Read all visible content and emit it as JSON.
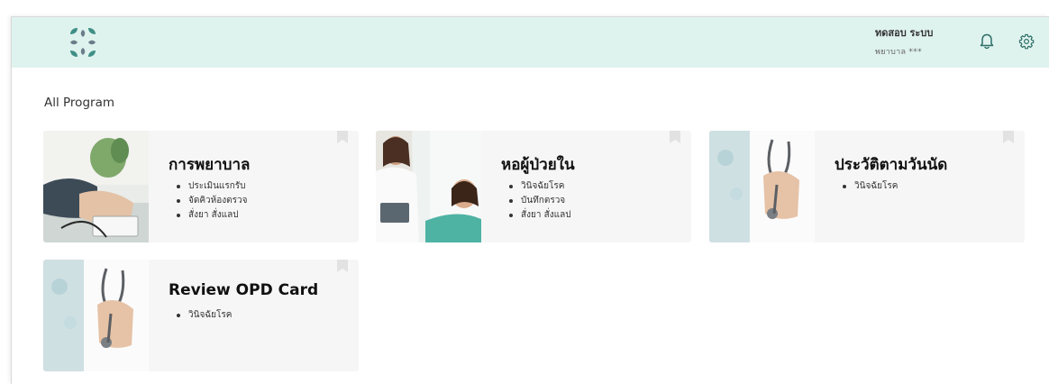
{
  "header": {
    "logo_icon": "clover-logo-icon",
    "user_name": "ทดสอบ ระบบ",
    "user_role": "พยาบาล ***",
    "bell_icon": "bell-icon",
    "settings_icon": "gear-icon",
    "bg_color": "#dff3ee",
    "logo_colors": [
      "#3f8f86",
      "#6b7d8a"
    ]
  },
  "main": {
    "section_title": "All Program",
    "cards": [
      {
        "title": "การพยาบาล",
        "items": [
          "ประเมินแรกรับ",
          "จัดคิวห้องตรวจ",
          "สั่งยา สั่งแลป"
        ],
        "image": "nurse-blood-pressure-photo"
      },
      {
        "title": "หอผู้ป่วยใน",
        "items": [
          "วินิจฉัยโรค",
          "บันทึกตรวจ",
          "สั่งยา สั่งแลป"
        ],
        "image": "doctor-with-patient-photo"
      },
      {
        "title": "ประวัติตามวันนัด",
        "items": [
          "วินิจฉัยโรค"
        ],
        "image": "doctor-stethoscope-photo"
      },
      {
        "title": "Review OPD Card",
        "items": [
          "วินิจฉัยโรค"
        ],
        "image": "doctor-stethoscope-photo"
      }
    ]
  }
}
